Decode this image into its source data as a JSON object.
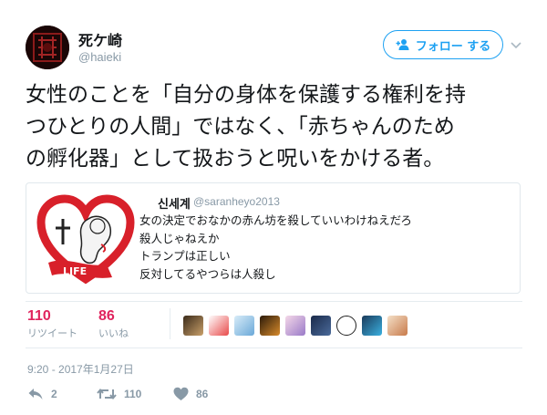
{
  "author": {
    "display_name": "死ケ崎",
    "handle": "@haieki"
  },
  "follow_button": {
    "label": "フォロー する"
  },
  "tweet": {
    "lines": [
      "女性のことを「自分の身体を保護する権利を持",
      "つひとりの人間」ではなく、「赤ちゃんのため",
      "の孵化器」として扱おうと呪いをかける者。"
    ]
  },
  "quoted_tweet": {
    "display_name": "신세계",
    "handle": "@saranheyo2013",
    "image_text": "LIFE",
    "lines": [
      "女の決定でおなかの赤ん坊を殺していいわけねえだろ",
      "殺人じゃねえか",
      "トランプは正しい",
      "反対してるやつらは人殺し"
    ]
  },
  "stats": {
    "retweets": {
      "count": "110",
      "label": "リツイート"
    },
    "likes": {
      "count": "86",
      "label": "いいね"
    }
  },
  "timestamp": "9:20 - 2017年1月27日",
  "actions": {
    "reply_count": "2",
    "retweet_count": "110",
    "like_count": "86"
  },
  "colors": {
    "accent_blue": "#1da1f2",
    "like_red": "#e0245e",
    "muted_gray": "#8899a6"
  }
}
